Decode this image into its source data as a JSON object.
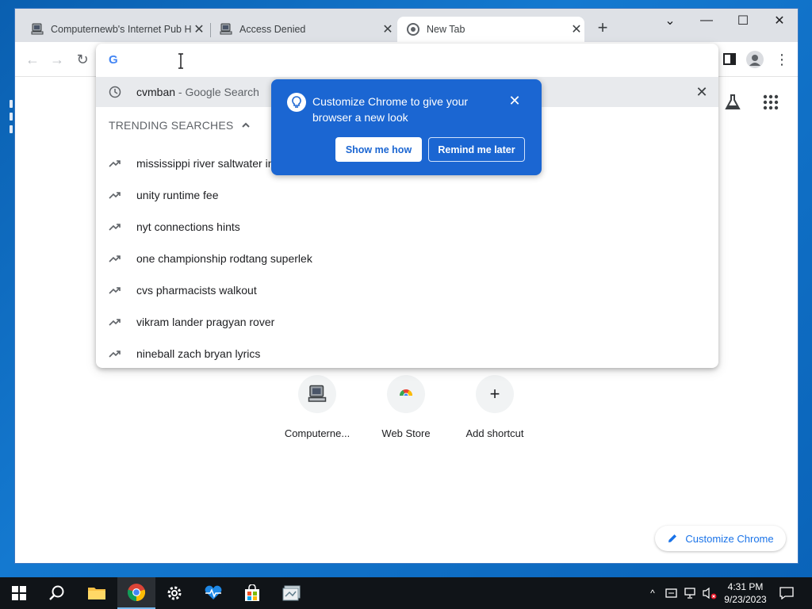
{
  "browser": {
    "tabs": [
      {
        "label": "Computernewb's Internet Pub Hub",
        "icon": "computer-icon",
        "active": false
      },
      {
        "label": "Access Denied",
        "icon": "computer-icon",
        "active": false
      },
      {
        "label": "New Tab",
        "icon": "chrome-icon",
        "active": true
      }
    ],
    "new_tab_symbol": "+",
    "window_controls": {
      "tab_search": "⌄",
      "minimize": "—",
      "maximize": "☐",
      "close": "✕"
    }
  },
  "toolbar": {
    "back": "←",
    "forward": "→",
    "reload": "↻",
    "menu": "⋮",
    "search_engine_letter": "G"
  },
  "omnibox": {
    "input_value": "",
    "recent": {
      "query": "cvmban",
      "suffix": "- Google Search",
      "remove": "✕"
    },
    "trending_header": "TRENDING SEARCHES",
    "trending": [
      "mississippi river saltwater in",
      "unity runtime fee",
      "nyt connections hints",
      "one championship rodtang superlek",
      "cvs pharmacists walkout",
      "vikram lander pragyan rover",
      "nineball zach bryan lyrics"
    ]
  },
  "promo": {
    "text": "Customize Chrome to give your browser a new look",
    "close": "✕",
    "primary_button": "Show me how",
    "secondary_button": "Remind me later",
    "color": "#1b66d2"
  },
  "shortcuts": [
    {
      "label": "Computerne...",
      "icon": "computer-icon"
    },
    {
      "label": "Web Store",
      "icon": "web-store-icon"
    },
    {
      "label": "Add shortcut",
      "icon": "plus-icon",
      "symbol": "+"
    }
  ],
  "customize_button": "Customize Chrome",
  "taskbar": {
    "time": "4:31 PM",
    "date": "9/23/2023",
    "tray_chevron": "^",
    "accent": "#76b9ed"
  }
}
